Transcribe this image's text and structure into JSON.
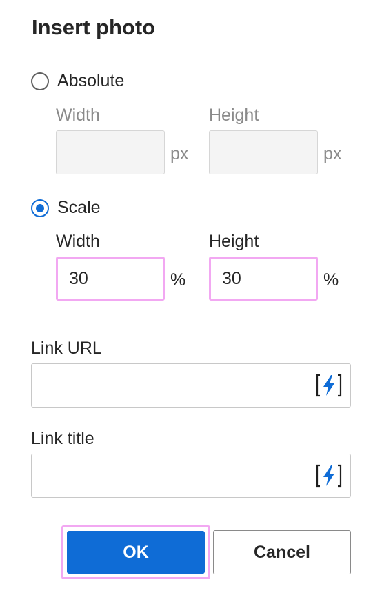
{
  "dialog": {
    "title": "Insert photo"
  },
  "absolute": {
    "label": "Absolute",
    "selected": false,
    "width_label": "Width",
    "height_label": "Height",
    "width_value": "",
    "height_value": "",
    "unit": "px"
  },
  "scale": {
    "label": "Scale",
    "selected": true,
    "width_label": "Width",
    "height_label": "Height",
    "width_value": "30",
    "height_value": "30",
    "unit": "%"
  },
  "link_url": {
    "label": "Link URL",
    "value": "",
    "icon": "lightning-bolt-icon"
  },
  "link_title": {
    "label": "Link title",
    "value": "",
    "icon": "lightning-bolt-icon"
  },
  "buttons": {
    "ok": "OK",
    "cancel": "Cancel"
  },
  "colors": {
    "accent": "#0f6cd6",
    "focus_outline": "#f2a8f2"
  }
}
